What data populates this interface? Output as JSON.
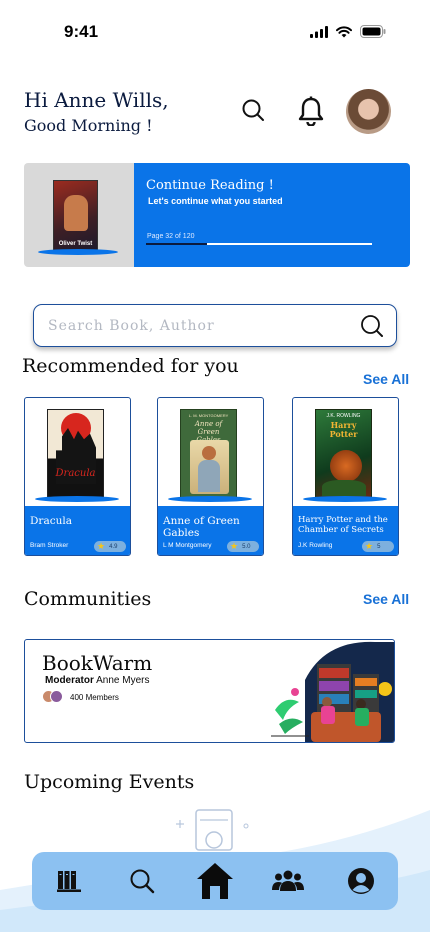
{
  "status_bar": {
    "time": "9:41"
  },
  "header": {
    "greeting": "Hi Anne Wills,",
    "subtitle": "Good Morning !"
  },
  "continue_reading": {
    "title": "Continue Reading !",
    "subtitle": "Let's continue what you started",
    "page_label": "Page 32 of 120",
    "progress_fraction": 0.27,
    "book_cover_text": "Oliver Twist"
  },
  "search": {
    "placeholder": "Search Book, Author"
  },
  "recommended": {
    "title": "Recommended for you",
    "see_all": "See All",
    "books": [
      {
        "title": "Dracula",
        "author": "Bram Stroker",
        "rating": "4.9",
        "cover_text": "Dracula"
      },
      {
        "title": "Anne of Green Gables",
        "author": "L M Montgomery",
        "rating": "5.0",
        "cover_text_top": "L. M. MONTGOMERY",
        "cover_text": "Anne of Green Gables"
      },
      {
        "title": "Harry Potter and the Chamber of Secrets",
        "author": "J.K Rowling",
        "rating": "5",
        "cover_text_top": "J.K. ROWLING",
        "cover_text": "Harry Potter"
      }
    ]
  },
  "communities": {
    "title": "Communities",
    "see_all": "See All",
    "items": [
      {
        "name": "BookWarm",
        "moderator_label": "Moderator",
        "moderator": "Anne Myers",
        "members": "400 Members"
      }
    ]
  },
  "events": {
    "title": "Upcoming Events"
  },
  "nav": {
    "items": [
      "library-icon",
      "search-icon",
      "home-icon",
      "community-icon",
      "profile-icon"
    ]
  },
  "colors": {
    "primary": "#0a74e8",
    "navy": "#0b1b3f",
    "nav_bg": "#8cc1f1",
    "link": "#1971d6"
  }
}
